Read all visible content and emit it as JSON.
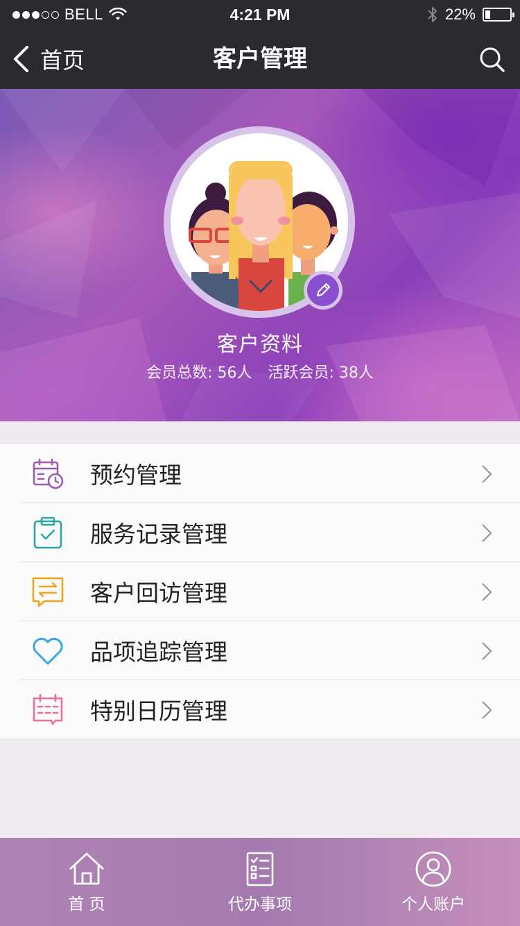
{
  "status_bar": {
    "carrier": "BELL",
    "time": "4:21 PM",
    "battery_percent": "22%",
    "battery_level": 0.22,
    "signal_bars_filled": 3,
    "signal_bars_total": 5
  },
  "nav": {
    "back_label": "首页",
    "title": "客户管理",
    "search_icon": "search-icon"
  },
  "hero": {
    "title": "客户资料",
    "member_total": "会员总数: 56人",
    "member_active": "活跃会员: 38人",
    "accent": "#8a4fcf"
  },
  "menu": {
    "items": [
      {
        "label": "预约管理",
        "icon": "calendar-clock-icon",
        "color": "#9c5bb3"
      },
      {
        "label": "服务记录管理",
        "icon": "clipboard-check-icon",
        "color": "#2aa6a0"
      },
      {
        "label": "客户回访管理",
        "icon": "chat-arrows-icon",
        "color": "#f0a21e"
      },
      {
        "label": "品项追踪管理",
        "icon": "heart-icon",
        "color": "#3aa6e6"
      },
      {
        "label": "特别日历管理",
        "icon": "calendar-grid-icon",
        "color": "#ef6f92"
      }
    ]
  },
  "tabs": [
    {
      "label": "首 页",
      "icon": "home-icon"
    },
    {
      "label": "代办事项",
      "icon": "checklist-icon"
    },
    {
      "label": "个人账户",
      "icon": "user-icon"
    }
  ]
}
